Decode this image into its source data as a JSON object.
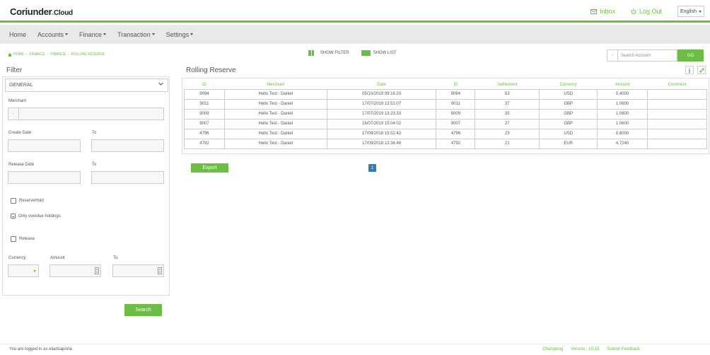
{
  "app": {
    "logo_main": "Coriunder",
    "logo_dot": ".",
    "logo_suffix": "Cloud"
  },
  "topbar": {
    "inbox_label": "Inbox",
    "logout_label": "Log Out",
    "language": "English",
    "accent_color": "#6cbd45"
  },
  "nav": {
    "items": [
      {
        "label": "Home",
        "has_caret": false
      },
      {
        "label": "Accounts",
        "has_caret": true
      },
      {
        "label": "Finance",
        "has_caret": true
      },
      {
        "label": "Transaction",
        "has_caret": true
      },
      {
        "label": "Settings",
        "has_caret": true
      }
    ]
  },
  "breadcrumb": {
    "items": [
      "HOME",
      "FINANCE",
      "FINANCE",
      "ROLLING RESERVE"
    ]
  },
  "toggles": {
    "show_filter": "SHOW FILTER",
    "show_list": "SHOW LIST"
  },
  "search": {
    "prefix": "-",
    "placeholder": "Search Account",
    "go_label": "GO"
  },
  "filter": {
    "title": "Filter",
    "section": "GENERAL",
    "merchant_label": "Merchant",
    "merchant_prefix": "-",
    "create_date_label": "Create Date",
    "to_label": "To",
    "release_date_label": "Release Date",
    "reserve_hold_label": "ReserveHold",
    "only_overdue_label": "Only overdue holdings",
    "release_label": "Release",
    "currency_label": "Currency",
    "amount_label": "Amount",
    "search_button": "Search"
  },
  "main": {
    "title": "Rolling Reserve",
    "export_button": "Export",
    "current_page": "1"
  },
  "table": {
    "headers": [
      "ID",
      "Merchant",
      "Date",
      "ID",
      "Settlement",
      "Currency",
      "Amount",
      "Comment"
    ],
    "rows": [
      [
        "9094",
        "Hello Test - Daniel",
        "05/10/2019 09:16:20",
        "9094",
        "53",
        "USD",
        "0.4000",
        ""
      ],
      [
        "9011",
        "Hello Test - Daniel",
        "17/07/2019 13:51:07",
        "9011",
        "37",
        "GBP",
        "1.0600",
        ""
      ],
      [
        "9009",
        "Hello Test - Daniel",
        "17/07/2019 13:23:33",
        "9009",
        "35",
        "GBP",
        "1.0600",
        ""
      ],
      [
        "9007",
        "Hello Test - Daniel",
        "16/07/2019 15:04:02",
        "9007",
        "27",
        "GBP",
        "1.0600",
        ""
      ],
      [
        "4796",
        "Hello Test - Daniel",
        "17/09/2018 15:02:42",
        "4796",
        "23",
        "USD",
        "0.8000",
        ""
      ],
      [
        "4792",
        "Hello Test - Daniel",
        "17/09/2018 13:34:48",
        "4792",
        "21",
        "EUR",
        "4.7240",
        ""
      ]
    ]
  },
  "footer": {
    "logged_in": "You are logged in as eliadsaporta",
    "changelog": "Changelog",
    "version": "Version : 10.15",
    "feedback": "Submit Feedback"
  }
}
